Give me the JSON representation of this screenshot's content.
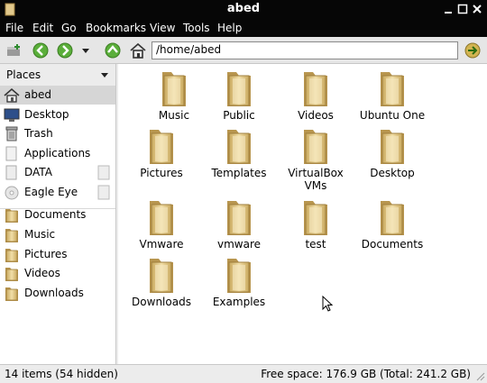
{
  "window": {
    "title": "abed"
  },
  "menu": [
    "File",
    "Edit",
    "Go",
    "Bookmarks",
    "View",
    "Tools",
    "Help"
  ],
  "location": {
    "path": "/home/abed"
  },
  "sidebar": {
    "header": "Places",
    "items": [
      {
        "label": "abed",
        "icon": "home-icon"
      },
      {
        "label": "Desktop",
        "icon": "desktop-icon"
      },
      {
        "label": "Trash",
        "icon": "trash-icon"
      },
      {
        "label": "Applications",
        "icon": "applications-icon"
      },
      {
        "label": "DATA",
        "icon": "drive-icon"
      },
      {
        "label": "Eagle Eye",
        "icon": "disc-icon"
      }
    ],
    "bookmarks": [
      {
        "label": "Documents",
        "icon": "folder-icon"
      },
      {
        "label": "Music",
        "icon": "folder-icon"
      },
      {
        "label": "Pictures",
        "icon": "folder-icon"
      },
      {
        "label": "Videos",
        "icon": "folder-icon"
      },
      {
        "label": "Downloads",
        "icon": "folder-icon"
      }
    ]
  },
  "files": [
    {
      "name": "Music"
    },
    {
      "name": "Public"
    },
    {
      "name": "Videos"
    },
    {
      "name": "Ubuntu One"
    },
    {
      "name": "Pictures"
    },
    {
      "name": "Templates"
    },
    {
      "name": "VirtualBox VMs"
    },
    {
      "name": "Desktop"
    },
    {
      "name": "Vmware"
    },
    {
      "name": "vmware"
    },
    {
      "name": "test"
    },
    {
      "name": "Documents"
    },
    {
      "name": "Downloads"
    },
    {
      "name": "Examples"
    }
  ],
  "status": {
    "items": "14 items (54 hidden)",
    "free_space": "Free space: 176.9 GB (Total: 241.2 GB)"
  },
  "colors": {
    "titlebar": "#060606",
    "folder": "#e2c98c",
    "selection": "#d6d6d6"
  }
}
